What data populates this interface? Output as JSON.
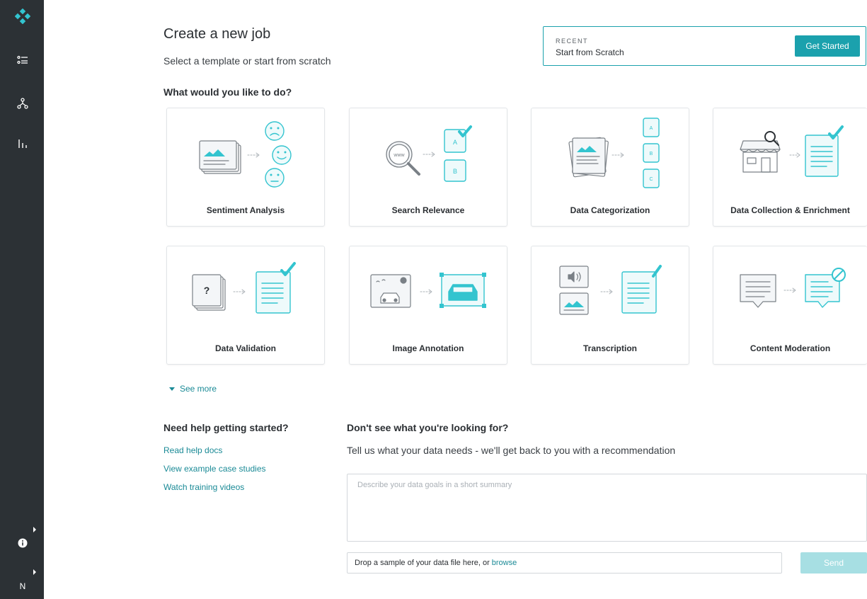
{
  "sidebar": {
    "items": [
      {
        "icon": "logo-icon"
      },
      {
        "icon": "task-list-icon"
      },
      {
        "icon": "workflow-icon"
      },
      {
        "icon": "bar-chart-icon"
      },
      {
        "icon": "info-icon"
      },
      {
        "icon": "user-avatar",
        "label": "N"
      }
    ]
  },
  "header": {
    "title": "Create a new job",
    "subtitle": "Select a template or start from scratch"
  },
  "recent": {
    "label": "RECENT",
    "item": "Start from Scratch",
    "button": "Get Started"
  },
  "templates": {
    "heading": "What would you like to do?",
    "cards": [
      {
        "label": "Sentiment Analysis",
        "icon": "sentiment-analysis-icon"
      },
      {
        "label": "Search Relevance",
        "icon": "search-relevance-icon"
      },
      {
        "label": "Data Categorization",
        "icon": "data-categorization-icon"
      },
      {
        "label": "Data Collection & Enrichment",
        "icon": "data-collection-icon"
      },
      {
        "label": "Data Validation",
        "icon": "data-validation-icon"
      },
      {
        "label": "Image Annotation",
        "icon": "image-annotation-icon"
      },
      {
        "label": "Transcription",
        "icon": "transcription-icon"
      },
      {
        "label": "Content Moderation",
        "icon": "content-moderation-icon"
      }
    ],
    "see_more": "See more"
  },
  "help": {
    "title": "Need help getting started?",
    "links": [
      "Read help docs",
      "View example case studies",
      "Watch training videos"
    ]
  },
  "request": {
    "title": "Don't see what you're looking for?",
    "subtitle": "Tell us what your data needs - we'll get back to you with a recommendation",
    "placeholder": "Describe your data goals in a short summary",
    "drop_text": "Drop a sample of your data file here, or",
    "browse": "browse",
    "send": "Send"
  },
  "colors": {
    "accent": "#1ba1ad",
    "sidebar": "#2c3135",
    "send_disabled": "#a7dfe3"
  }
}
